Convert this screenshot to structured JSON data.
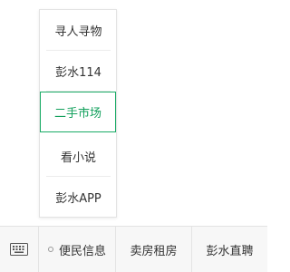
{
  "submenu": {
    "items": [
      {
        "label": "寻人寻物"
      },
      {
        "label": "彭水114"
      },
      {
        "label": "二手市场"
      },
      {
        "label": "看小说"
      },
      {
        "label": "彭水APP"
      }
    ],
    "selected_index": 2
  },
  "bottom_bar": {
    "keyboard_icon": "keyboard-icon",
    "menus": [
      {
        "label": "便民信息"
      },
      {
        "label": "卖房租房"
      },
      {
        "label": "彭水直聘"
      }
    ]
  },
  "colors": {
    "accent": "#1aab66",
    "bar_background": "#f7f7f7"
  }
}
